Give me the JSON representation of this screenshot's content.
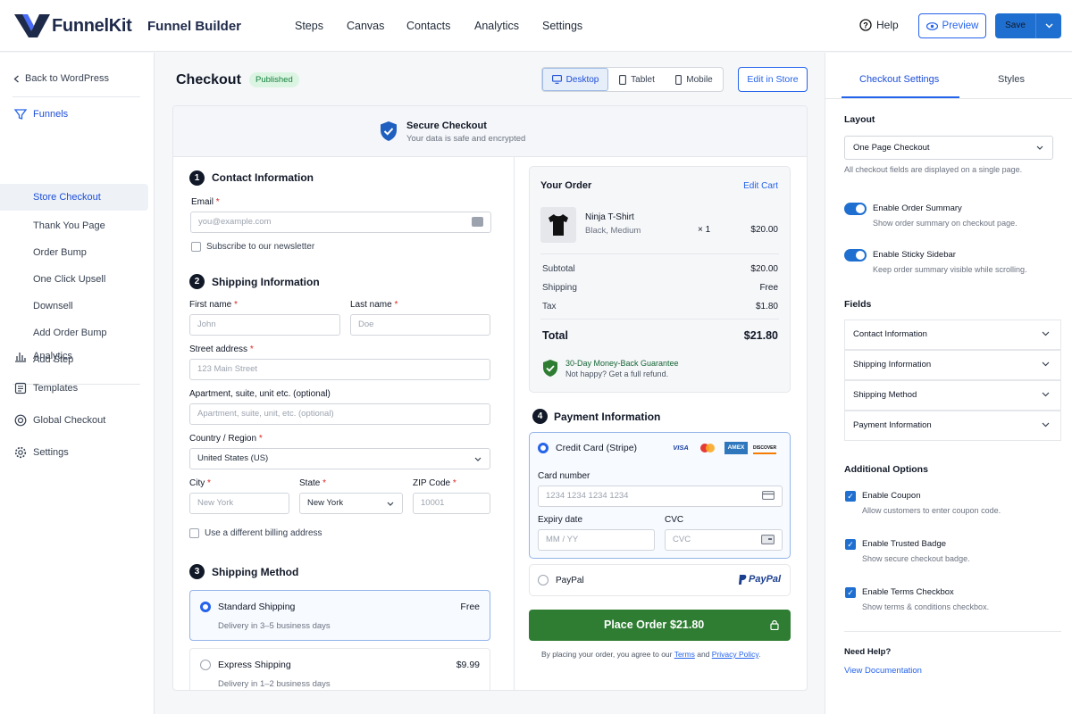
{
  "brand": {
    "logo_text": "FunnelKit",
    "app_title": "Funnel Builder"
  },
  "topnav": [
    "Steps",
    "Canvas",
    "Contacts",
    "Analytics",
    "Settings"
  ],
  "top_actions": {
    "help": "Help",
    "preview": "Preview",
    "save": "Save"
  },
  "sidebar": {
    "back": "Back to WordPress",
    "funnels": "Funnels",
    "steps": [
      "Store Checkout",
      "Thank You Page",
      "Order Bump",
      "One Click Upsell",
      "Downsell",
      "Add Order Bump",
      "Add Step"
    ],
    "bottom": [
      "Analytics",
      "Templates",
      "Global Checkout",
      "Settings"
    ]
  },
  "page": {
    "title": "Checkout",
    "status": "Published",
    "devices": [
      "Desktop",
      "Tablet",
      "Mobile"
    ],
    "edit_store": "Edit in Store"
  },
  "secure": {
    "title": "Secure Checkout",
    "subtitle": "Your data is safe and encrypted"
  },
  "contact": {
    "num": "1",
    "title": "Contact Information",
    "email_label": "Email",
    "req": "*",
    "email_placeholder": "you@example.com",
    "newsletter": "Subscribe to our newsletter"
  },
  "shipping": {
    "num": "2",
    "title": "Shipping Information",
    "first_label": "First name",
    "first_ph": "John",
    "last_label": "Last name",
    "last_ph": "Doe",
    "street_label": "Street address",
    "street_ph": "123 Main Street",
    "apt_label": "Apartment, suite, unit etc. (optional)",
    "apt_ph": "Apartment, suite, unit, etc. (optional)",
    "country_label": "Country / Region",
    "country_val": "United States (US)",
    "city_label": "City",
    "city_ph": "New York",
    "state_label": "State",
    "state_val": "New York",
    "zip_label": "ZIP Code",
    "zip_ph": "10001",
    "billing": "Use a different billing address"
  },
  "method": {
    "num": "3",
    "title": "Shipping Method",
    "options": [
      {
        "name": "Standard Shipping",
        "desc": "Delivery in 3–5 business days",
        "price": "Free"
      },
      {
        "name": "Express Shipping",
        "desc": "Delivery in 1–2 business days",
        "price": "$9.99"
      }
    ]
  },
  "order": {
    "title": "Your Order",
    "edit_cart": "Edit Cart",
    "product": "Ninja T-Shirt",
    "variant": "Black, Medium",
    "qty": "× 1",
    "price": "$20.00",
    "subtotal_label": "Subtotal",
    "subtotal": "$20.00",
    "shipping_label": "Shipping",
    "shipping": "Free",
    "tax_label": "Tax",
    "tax": "$1.80",
    "total_label": "Total",
    "total": "$21.80",
    "guarantee_title": "30-Day Money-Back Guarantee",
    "guarantee_sub": "Not happy? Get a full refund."
  },
  "payment": {
    "num": "4",
    "title": "Payment Information",
    "cc_label": "Credit Card (Stripe)",
    "cards": [
      "VISA",
      "AMEX",
      "DISCOVER"
    ],
    "card_number_label": "Card number",
    "card_number_ph": "1234 1234 1234 1234",
    "expiry_label": "Expiry date",
    "expiry_ph": "MM / YY",
    "cvc_label": "CVC",
    "cvc_ph": "CVC",
    "paypal_label": "PayPal",
    "paypal_logo": "PayPal",
    "place_order": "Place Order",
    "place_amount": "$21.80",
    "terms_prefix": "By placing your order, you agree to our",
    "terms": "Terms",
    "and": "and",
    "privacy": "Privacy Policy",
    "period": "."
  },
  "right": {
    "tabs": [
      "Checkout Settings",
      "Styles"
    ],
    "layout_title": "Layout",
    "layout_value": "One Page Checkout",
    "layout_note": "All checkout fields are displayed on a single page.",
    "toggles": [
      {
        "label": "Enable Order Summary",
        "desc": "Show order summary on checkout page."
      },
      {
        "label": "Enable Sticky Sidebar",
        "desc": "Keep order summary visible while scrolling."
      }
    ],
    "fields_title": "Fields",
    "fields": [
      "Contact Information",
      "Shipping Information",
      "Shipping Method",
      "Payment Information"
    ],
    "additional_title": "Additional Options",
    "options": [
      {
        "label": "Enable Coupon",
        "desc": "Allow customers to enter coupon code."
      },
      {
        "label": "Enable Trusted Badge",
        "desc": "Show secure checkout badge."
      },
      {
        "label": "Enable Terms Checkbox",
        "desc": "Show terms & conditions checkbox."
      }
    ],
    "help_title": "Need Help?",
    "help_link": "View Documentation"
  },
  "colors": {
    "accent": "#1f6fd1",
    "success": "#2e7d32",
    "brand_navy": "#1e2a4a"
  }
}
